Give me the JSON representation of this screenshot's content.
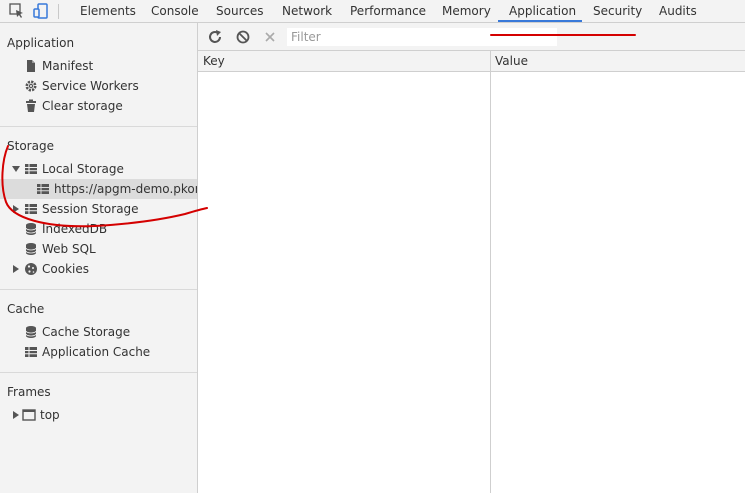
{
  "tabs": [
    "Elements",
    "Console",
    "Sources",
    "Network",
    "Performance",
    "Memory",
    "Application",
    "Security",
    "Audits"
  ],
  "active_tab": "Application",
  "sidebar": {
    "application": {
      "title": "Application",
      "items": [
        "Manifest",
        "Service Workers",
        "Clear storage"
      ]
    },
    "storage": {
      "title": "Storage",
      "local_storage": "Local Storage",
      "local_storage_child": "https://apgm-demo.pkonda",
      "session_storage": "Session Storage",
      "indexeddb": "IndexedDB",
      "websql": "Web SQL",
      "cookies": "Cookies"
    },
    "cache": {
      "title": "Cache",
      "items": [
        "Cache Storage",
        "Application Cache"
      ]
    },
    "frames": {
      "title": "Frames",
      "top": "top"
    }
  },
  "toolbar": {
    "filter_placeholder": "Filter",
    "icons": [
      "refresh-icon",
      "clear-block-icon",
      "delete-icon"
    ]
  },
  "grid": {
    "columns": [
      "Key",
      "Value"
    ]
  },
  "colors": {
    "accent": "#3879d9",
    "annotation": "#d40000",
    "panel_bg": "#f3f3f3"
  }
}
